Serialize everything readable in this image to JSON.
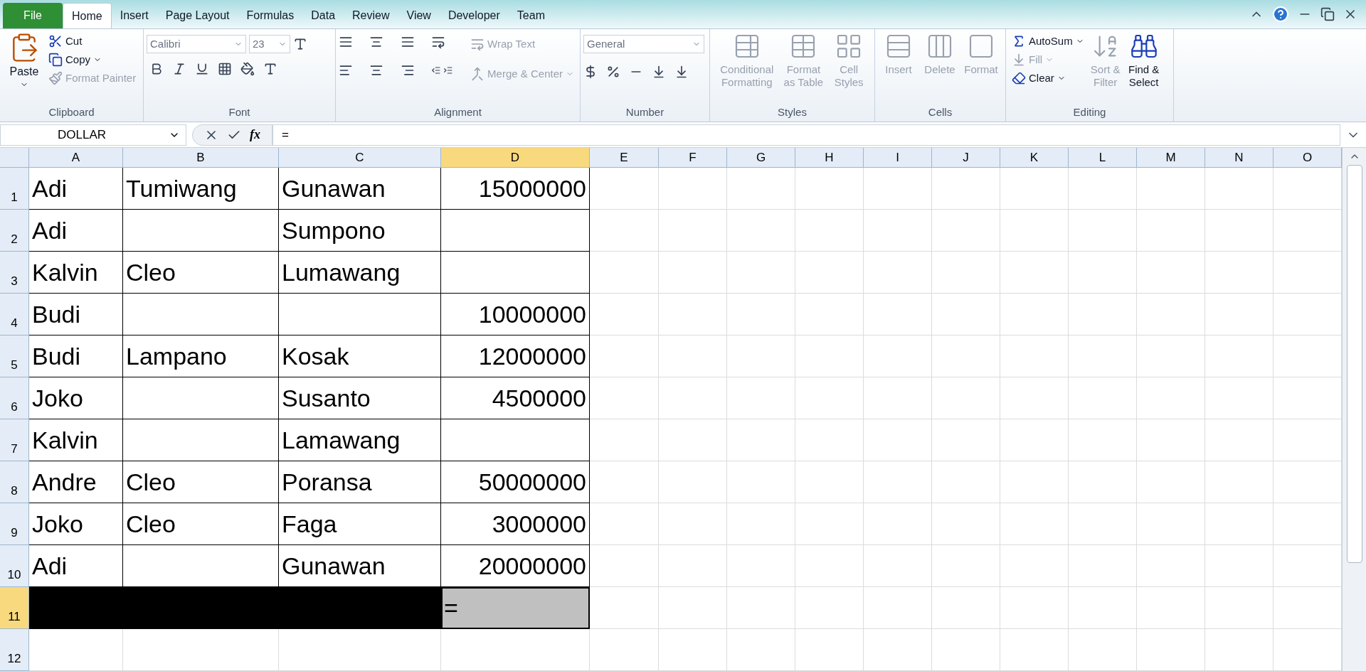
{
  "tabs": [
    {
      "label": "File",
      "kind": "file",
      "selected": false
    },
    {
      "label": "Home",
      "kind": "tab",
      "selected": true
    },
    {
      "label": "Insert",
      "kind": "tab",
      "selected": false
    },
    {
      "label": "Page Layout",
      "kind": "tab",
      "selected": false
    },
    {
      "label": "Formulas",
      "kind": "tab",
      "selected": false
    },
    {
      "label": "Data",
      "kind": "tab",
      "selected": false
    },
    {
      "label": "Review",
      "kind": "tab",
      "selected": false
    },
    {
      "label": "View",
      "kind": "tab",
      "selected": false
    },
    {
      "label": "Developer",
      "kind": "tab",
      "selected": false
    },
    {
      "label": "Team",
      "kind": "tab",
      "selected": false
    }
  ],
  "ribbon": {
    "clipboard": {
      "label": "Clipboard",
      "paste": {
        "label": "Paste",
        "disabled": false
      },
      "cut": {
        "label": "Cut",
        "disabled": false
      },
      "copy": {
        "label": "Copy",
        "disabled": false
      },
      "format_painter": {
        "label": "Format Painter",
        "disabled": true
      }
    },
    "font": {
      "label": "Font",
      "font_name": "Calibri",
      "font_size": "23"
    },
    "alignment": {
      "label": "Alignment",
      "wrap_text": {
        "label": "Wrap Text",
        "disabled": true
      },
      "merge_center": {
        "label": "Merge & Center",
        "disabled": true
      }
    },
    "number": {
      "label": "Number",
      "format": "General"
    },
    "styles": {
      "label": "Styles",
      "buttons": [
        {
          "label": "Conditional Formatting",
          "disabled": true
        },
        {
          "label": "Format as Table",
          "disabled": true
        },
        {
          "label": "Cell Styles",
          "disabled": true
        }
      ]
    },
    "cells": {
      "label": "Cells",
      "buttons": [
        {
          "label": "Insert",
          "disabled": true
        },
        {
          "label": "Delete",
          "disabled": true
        },
        {
          "label": "Format",
          "disabled": true
        }
      ]
    },
    "editing": {
      "label": "Editing",
      "autosum": {
        "label": "AutoSum",
        "disabled": false
      },
      "fill": {
        "label": "Fill",
        "disabled": true
      },
      "clear": {
        "label": "Clear",
        "disabled": false
      },
      "sort_filter": {
        "label": "Sort & Filter",
        "disabled": true
      },
      "find_select": {
        "label": "Find & Select",
        "disabled": false
      }
    }
  },
  "formula_bar": {
    "name_box": "DOLLAR",
    "function_label": "fx",
    "formula": "="
  },
  "columns": [
    {
      "label": "A",
      "selected": false
    },
    {
      "label": "B",
      "selected": false
    },
    {
      "label": "C",
      "selected": false
    },
    {
      "label": "D",
      "selected": true
    },
    {
      "label": "E",
      "selected": false
    },
    {
      "label": "F",
      "selected": false
    },
    {
      "label": "G",
      "selected": false
    },
    {
      "label": "H",
      "selected": false
    },
    {
      "label": "I",
      "selected": false
    },
    {
      "label": "J",
      "selected": false
    },
    {
      "label": "K",
      "selected": false
    },
    {
      "label": "L",
      "selected": false
    },
    {
      "label": "M",
      "selected": false
    },
    {
      "label": "N",
      "selected": false
    },
    {
      "label": "O",
      "selected": false
    }
  ],
  "rows": [
    {
      "label": "1",
      "selected": false,
      "cells": [
        {
          "kind": "text",
          "text": "Adi"
        },
        {
          "kind": "text",
          "text": "Tumiwang"
        },
        {
          "kind": "text",
          "text": "Gunawan"
        },
        {
          "kind": "number",
          "text": "15000000"
        }
      ]
    },
    {
      "label": "2",
      "selected": false,
      "cells": [
        {
          "kind": "text",
          "text": "Adi"
        },
        {
          "kind": "empty"
        },
        {
          "kind": "text",
          "text": "Sumpono"
        },
        {
          "kind": "empty"
        }
      ]
    },
    {
      "label": "3",
      "selected": false,
      "cells": [
        {
          "kind": "text",
          "text": "Kalvin"
        },
        {
          "kind": "text",
          "text": "Cleo"
        },
        {
          "kind": "text",
          "text": "Lumawang"
        },
        {
          "kind": "empty"
        }
      ]
    },
    {
      "label": "4",
      "selected": false,
      "cells": [
        {
          "kind": "text",
          "text": "Budi"
        },
        {
          "kind": "empty"
        },
        {
          "kind": "empty"
        },
        {
          "kind": "number",
          "text": "10000000"
        }
      ]
    },
    {
      "label": "5",
      "selected": false,
      "cells": [
        {
          "kind": "text",
          "text": "Budi"
        },
        {
          "kind": "text",
          "text": "Lampano"
        },
        {
          "kind": "text",
          "text": "Kosak"
        },
        {
          "kind": "number",
          "text": "12000000"
        }
      ]
    },
    {
      "label": "6",
      "selected": false,
      "cells": [
        {
          "kind": "text",
          "text": "Joko"
        },
        {
          "kind": "empty"
        },
        {
          "kind": "text",
          "text": "Susanto"
        },
        {
          "kind": "number",
          "text": "4500000"
        }
      ]
    },
    {
      "label": "7",
      "selected": false,
      "cells": [
        {
          "kind": "text",
          "text": "Kalvin"
        },
        {
          "kind": "empty"
        },
        {
          "kind": "text",
          "text": "Lamawang"
        },
        {
          "kind": "empty"
        }
      ]
    },
    {
      "label": "8",
      "selected": false,
      "cells": [
        {
          "kind": "text",
          "text": "Andre"
        },
        {
          "kind": "text",
          "text": "Cleo"
        },
        {
          "kind": "text",
          "text": "Poransa"
        },
        {
          "kind": "number",
          "text": "50000000"
        }
      ]
    },
    {
      "label": "9",
      "selected": false,
      "cells": [
        {
          "kind": "text",
          "text": "Joko"
        },
        {
          "kind": "text",
          "text": "Cleo"
        },
        {
          "kind": "text",
          "text": "Faga"
        },
        {
          "kind": "number",
          "text": "3000000"
        }
      ]
    },
    {
      "label": "10",
      "selected": false,
      "cells": [
        {
          "kind": "text",
          "text": "Adi"
        },
        {
          "kind": "empty"
        },
        {
          "kind": "text",
          "text": "Gunawan"
        },
        {
          "kind": "number",
          "text": "20000000"
        }
      ]
    },
    {
      "label": "11",
      "selected": true,
      "cells": [
        {
          "kind": "empty",
          "color": "#000000"
        },
        {
          "kind": "empty",
          "color": "#000000"
        },
        {
          "kind": "empty",
          "color": "#000000"
        },
        {
          "kind": "text",
          "text": "=",
          "color": "#c0c0c0"
        }
      ]
    },
    {
      "label": "12",
      "selected": false,
      "cells": []
    }
  ]
}
